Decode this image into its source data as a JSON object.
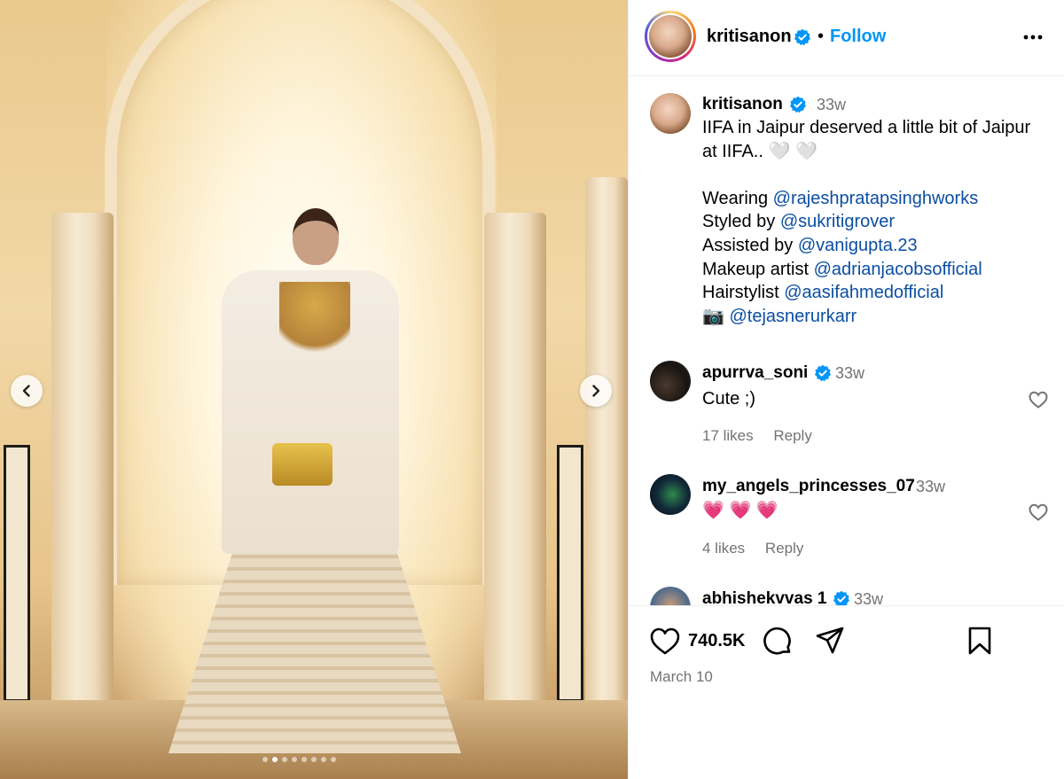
{
  "post": {
    "username": "kritisanon",
    "separator": "•",
    "follow_label": "Follow",
    "more_icon": "more-horizontal-icon"
  },
  "caption": {
    "username": "kritisanon",
    "time": "33w",
    "line1": "IIFA in Jaipur deserved a little bit of Jaipur",
    "line2": "at IIFA..",
    "line2_emoji": "🤍 🤍",
    "credits": [
      {
        "label": "Wearing ",
        "handle": "@rajeshpratapsinghworks"
      },
      {
        "label": "Styled by ",
        "handle": "@sukritigrover"
      },
      {
        "label": "Assisted by ",
        "handle": "@vanigupta.23"
      },
      {
        "label": "Makeup artist ",
        "handle": "@adrianjacobsofficial"
      },
      {
        "label": "Hairstylist ",
        "handle": "@aasifahmedofficial"
      },
      {
        "label": "📷 ",
        "handle": "@tejasnerurkarr"
      }
    ]
  },
  "comments": [
    {
      "username": "apurrva_soni",
      "time": "33w",
      "text": "Cute ;)",
      "likes": "17 likes",
      "reply": "Reply"
    },
    {
      "username": "my_angels_princesses_07",
      "time": "33w",
      "text": "💗 💗 💗",
      "likes": "4 likes",
      "reply": "Reply"
    },
    {
      "username": "abhishekvvas 1",
      "time": "33w"
    }
  ],
  "actions": {
    "like_count": "740.5K",
    "date": "March 10"
  },
  "carousel": {
    "total_slides": 8,
    "current_slide": 2
  },
  "colors": {
    "follow": "#0095f6",
    "link": "#0b4ea2",
    "verified": "#0095f6",
    "muted": "#737373"
  }
}
